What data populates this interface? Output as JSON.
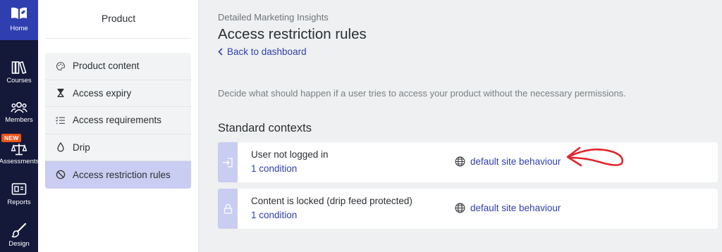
{
  "rail": {
    "items": [
      {
        "label": "Home",
        "icon": "open-book-icon"
      },
      {
        "label": "Courses",
        "icon": "books-icon"
      },
      {
        "label": "Members",
        "icon": "people-icon"
      },
      {
        "label": "Assessments",
        "icon": "scales-icon"
      },
      {
        "label": "Reports",
        "icon": "report-icon"
      },
      {
        "label": "Design",
        "icon": "paintbrush-icon"
      }
    ],
    "new_badge": "NEW"
  },
  "sidebar": {
    "title": "Product",
    "items": [
      {
        "label": "Product content",
        "icon": "palette-icon"
      },
      {
        "label": "Access expiry",
        "icon": "hourglass-icon"
      },
      {
        "label": "Access requirements",
        "icon": "checklist-icon"
      },
      {
        "label": "Drip",
        "icon": "droplet-icon"
      },
      {
        "label": "Access restriction rules",
        "icon": "prohibited-icon",
        "active": true
      }
    ]
  },
  "main": {
    "eyebrow": "Detailed Marketing Insights",
    "title": "Access restriction rules",
    "back_label": "Back to dashboard",
    "description": "Decide what should happen if a user tries to access your product without the necessary permissions.",
    "section_title": "Standard contexts",
    "contexts": [
      {
        "name": "User not logged in",
        "conditions": "1 condition",
        "behaviour": "default site behaviour",
        "icon": "sign-in-icon"
      },
      {
        "name": "Content is locked (drip feed protected)",
        "conditions": "1 condition",
        "behaviour": "default site behaviour",
        "icon": "lock-icon"
      }
    ]
  },
  "colors": {
    "rail_bg": "#14193a",
    "rail_active": "#2f3fb0",
    "accent": "#2f3fb0",
    "active_item_bg": "#c9cdf1",
    "new_badge": "#e8531a",
    "annotation_arrow": "#e0252b"
  }
}
